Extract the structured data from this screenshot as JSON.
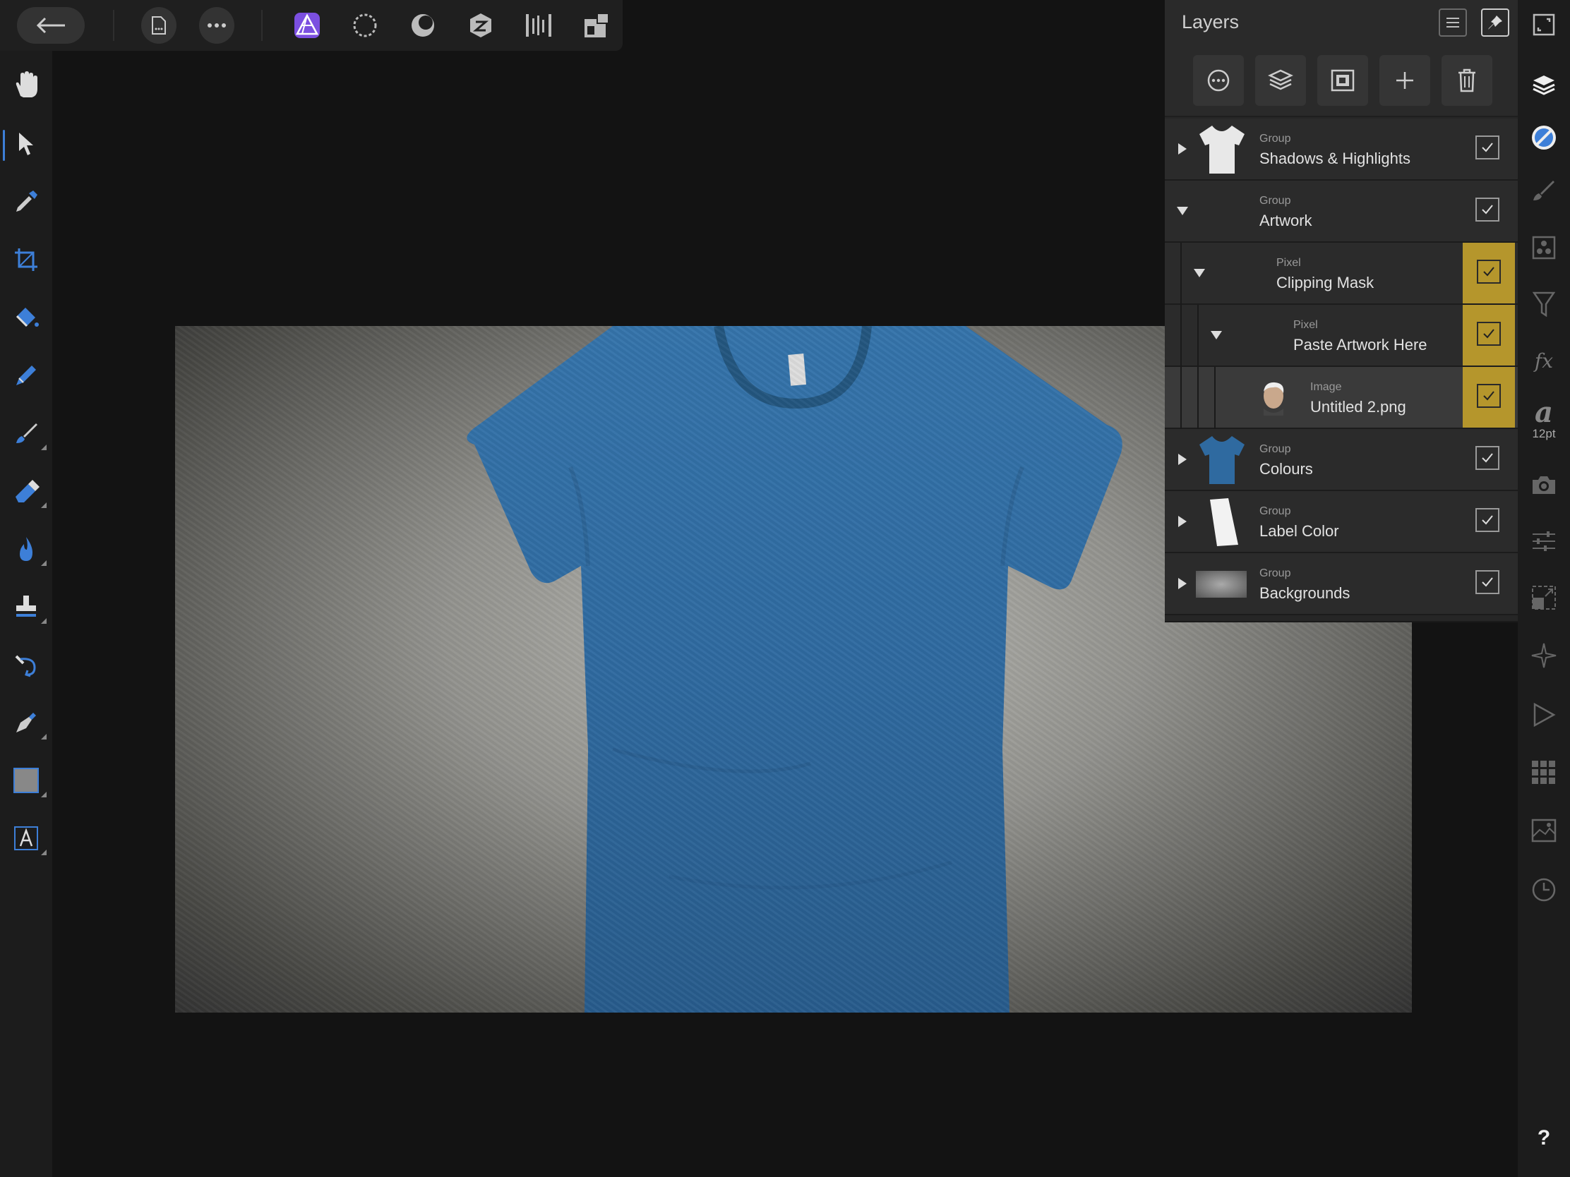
{
  "topbar": {
    "back_icon": "arrow-left-icon",
    "document_icon": "document-icon",
    "more_icon": "ellipsis-icon",
    "personas": [
      {
        "icon": "photo-persona-icon",
        "active": true
      },
      {
        "icon": "liquify-persona-icon",
        "active": false
      },
      {
        "icon": "develop-persona-icon",
        "active": false
      },
      {
        "icon": "tone-mapping-persona-icon",
        "active": false
      },
      {
        "icon": "export-persona-icon",
        "active": false
      },
      {
        "icon": "arrange-icon",
        "active": false
      }
    ]
  },
  "tools": [
    "hand-tool",
    "move-tool",
    "color-picker-tool",
    "crop-tool",
    "flood-fill-tool",
    "selection-brush-tool",
    "paint-brush-tool",
    "erase-brush-tool",
    "dodge-brush-tool",
    "clone-brush-tool",
    "healing-brush-tool",
    "pen-tool",
    "rectangle-tool",
    "text-tool"
  ],
  "layers_panel": {
    "title": "Layers",
    "rows": [
      {
        "type": "Group",
        "name": "Shadows & Highlights",
        "expanded": false,
        "indent": 0,
        "highlighted": false,
        "selected": false,
        "thumb": "white-tshirt"
      },
      {
        "type": "Group",
        "name": "Artwork",
        "expanded": true,
        "indent": 0,
        "highlighted": false,
        "selected": false,
        "thumb": "none"
      },
      {
        "type": "Pixel",
        "name": "Clipping Mask",
        "expanded": true,
        "indent": 1,
        "highlighted": true,
        "selected": false,
        "thumb": "none"
      },
      {
        "type": "Pixel",
        "name": "Paste Artwork Here",
        "expanded": true,
        "indent": 2,
        "highlighted": true,
        "selected": false,
        "thumb": "none"
      },
      {
        "type": "Image",
        "name": "Untitled 2.png",
        "expanded": null,
        "indent": 3,
        "highlighted": true,
        "selected": true,
        "thumb": "face"
      },
      {
        "type": "Group",
        "name": "Colours",
        "expanded": false,
        "indent": 0,
        "highlighted": false,
        "selected": false,
        "thumb": "blue-tshirt"
      },
      {
        "type": "Group",
        "name": "Label Color",
        "expanded": false,
        "indent": 0,
        "highlighted": false,
        "selected": false,
        "thumb": "white-label"
      },
      {
        "type": "Group",
        "name": "Backgrounds",
        "expanded": false,
        "indent": 0,
        "highlighted": false,
        "selected": false,
        "thumb": "grey-texture"
      }
    ]
  },
  "studio": {
    "font_size_label": "12pt",
    "help_label": "?"
  },
  "colors": {
    "accent": "#3d7fd8",
    "persona_purple": "#7b4fe0",
    "highlight_gold": "#b5962c",
    "tshirt_blue": "#2f6aa0"
  }
}
